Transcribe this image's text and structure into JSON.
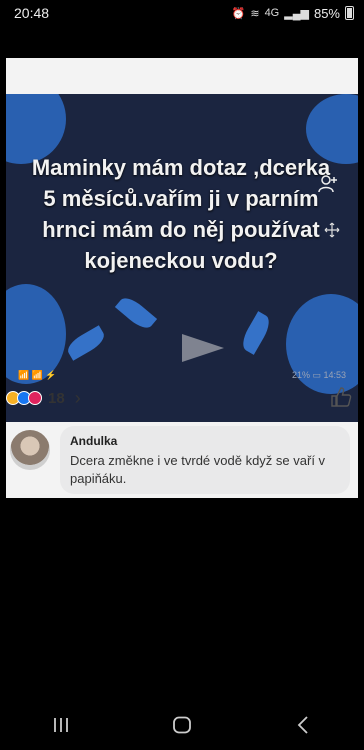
{
  "status_bar": {
    "time": "20:48",
    "network": "4G",
    "battery": "85%"
  },
  "post": {
    "question": "Maminky mám dotaz ,dcerka 5 měsíců.vařím ji v parním hrnci mám do něj používat kojeneckou vodu?",
    "inner_status_left": "📶 📶 ⚡",
    "inner_status_right": "21% ▭ 14:53"
  },
  "reactions": {
    "count": "18",
    "chevron": "›",
    "colors": [
      "#f7b125",
      "#1877f2",
      "#e0245e"
    ]
  },
  "comment": {
    "author": "Andulka",
    "text": "Dcera změkne i ve tvrdé vodě když se vaří v papiňáku."
  },
  "nav": {
    "icons": [
      "recent-apps-icon",
      "home-icon",
      "back-icon"
    ]
  }
}
